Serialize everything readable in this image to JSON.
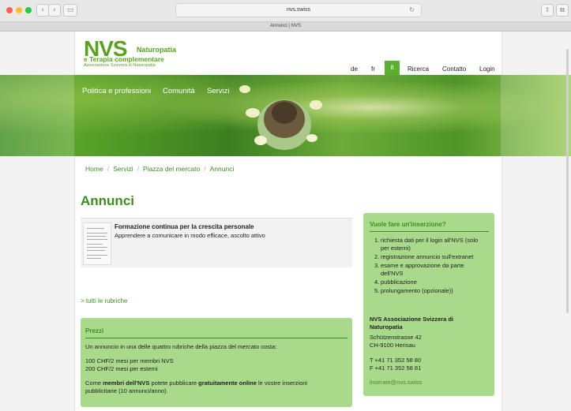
{
  "browser": {
    "url": "nvs.swiss",
    "tab_title": "Annunci | NVS",
    "back_glyph": "‹",
    "forward_glyph": "›",
    "sidebar_glyph": "▭",
    "reload_glyph": "↻",
    "share_glyph": "⇧",
    "tabs_glyph": "⧉"
  },
  "logo": {
    "nvs": "NVS",
    "naturopatia": "Naturopatia",
    "terapia": "e Terapia complementare",
    "association": "Associazione Svizzera di Naturopatia"
  },
  "topnav": {
    "de": "de",
    "fr": "fr",
    "it": "it",
    "ricerca": "Ricerca",
    "contatto": "Contatto",
    "login": "Login"
  },
  "mainnav": {
    "politica": "Politica e professioni",
    "comunita": "Comunità",
    "servizi": "Servizi"
  },
  "breadcrumb": [
    "Home",
    "Servizi",
    "Piazza del mercato",
    "Annunci"
  ],
  "page_title": "Annunci",
  "listing": {
    "title": "Formazione continua per la crescita personale",
    "subtitle": "Apprendere a comunicare in modo efficace, ascolto attivo"
  },
  "all_rubrics_link": "> tutti le rubriche",
  "prezzi": {
    "heading": "Prezzi",
    "intro": "Un annuncio in una delle quattro rubriche della piazza del mercato costa:",
    "price1": "100 CHF/2 mesi per membri NVS",
    "price2": "200 CHF/2 mesi per esterni",
    "note_pre": "Come ",
    "note_bold1": "membri dell'NVS",
    "note_mid": " potete pubblicare ",
    "note_bold2": "gratuitamente online",
    "note_post": " le vostre inserzioni",
    "note_line2": "pubblicitarie (10 annunci/anno)."
  },
  "sidebox": {
    "heading": "Vuole fare un'inserzione?",
    "steps": [
      {
        "n": "1.",
        "lines": [
          "richiesta dati per il login all'NVS (solo",
          "per esterni)"
        ]
      },
      {
        "n": "2.",
        "lines": [
          "registrazione annuncio sull'extranet"
        ]
      },
      {
        "n": "3.",
        "lines": [
          "esame e approvazione da parte",
          "dell'NVS"
        ]
      },
      {
        "n": "4.",
        "lines": [
          "pubblicazione"
        ]
      },
      {
        "n": "5.",
        "lines": [
          "prolungamento (opzionale))"
        ]
      }
    ],
    "org_line1": "NVS Associazione Svizzera di",
    "org_line2": "Naturopatia",
    "street": "Schützenstrasse 42",
    "city": "CH-9100 Herisau",
    "phone": "T +41 71 352 58 80",
    "fax": "F +41 71 352 58 81",
    "email": "inserate@nvs.swiss"
  },
  "colors": {
    "brand_green": "#5aa11f",
    "link_green": "#3d8f1f",
    "box_green": "#a9d98a"
  }
}
